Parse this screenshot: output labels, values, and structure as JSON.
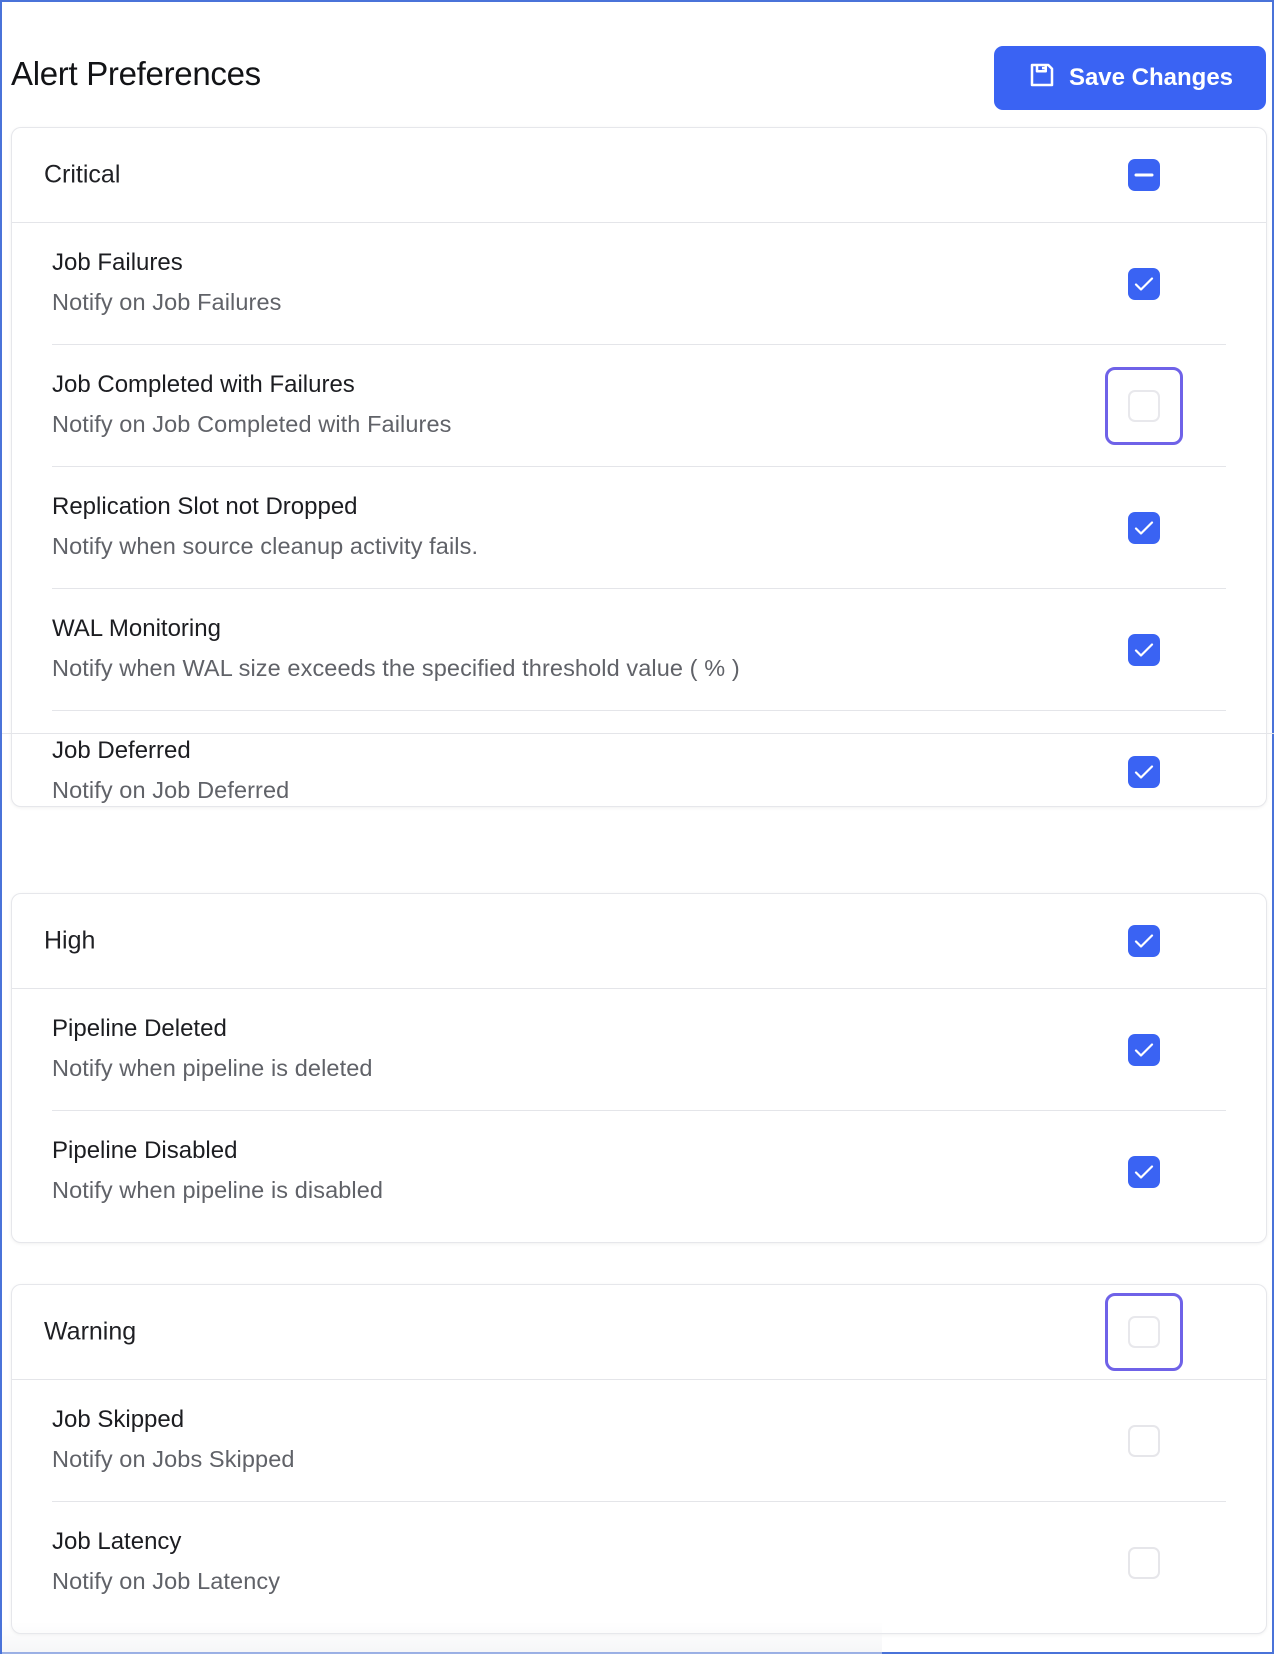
{
  "header": {
    "title": "Alert Preferences",
    "save_label": "Save Changes"
  },
  "colors": {
    "accent": "#3a63f3",
    "focus_ring": "#6f62e8",
    "frame_border": "#4a73d9"
  },
  "sections": [
    {
      "title": "Critical",
      "state": "indeterminate",
      "items": [
        {
          "title": "Job Failures",
          "description": "Notify on Job Failures",
          "checked": true
        },
        {
          "title": "Job Completed with Failures",
          "description": "Notify on Job Completed with Failures",
          "checked": false,
          "focused": true
        },
        {
          "title": "Replication Slot not Dropped",
          "description": "Notify when source cleanup activity fails.",
          "checked": true
        },
        {
          "title": "WAL Monitoring",
          "description": "Notify when WAL size exceeds the specified threshold value ( % )",
          "checked": true
        },
        {
          "title": "Job Deferred",
          "description": "Notify on Job Deferred",
          "checked": true
        }
      ]
    },
    {
      "title": "High",
      "state": "checked",
      "items": [
        {
          "title": "Pipeline Deleted",
          "description": "Notify when pipeline is deleted",
          "checked": true
        },
        {
          "title": "Pipeline Disabled",
          "description": "Notify when pipeline is disabled",
          "checked": true
        }
      ]
    },
    {
      "title": "Warning",
      "state": "unchecked",
      "focused": true,
      "items": [
        {
          "title": "Job Skipped",
          "description": "Notify on Jobs Skipped",
          "checked": false
        },
        {
          "title": "Job Latency",
          "description": "Notify on Job Latency",
          "checked": false
        }
      ]
    }
  ]
}
